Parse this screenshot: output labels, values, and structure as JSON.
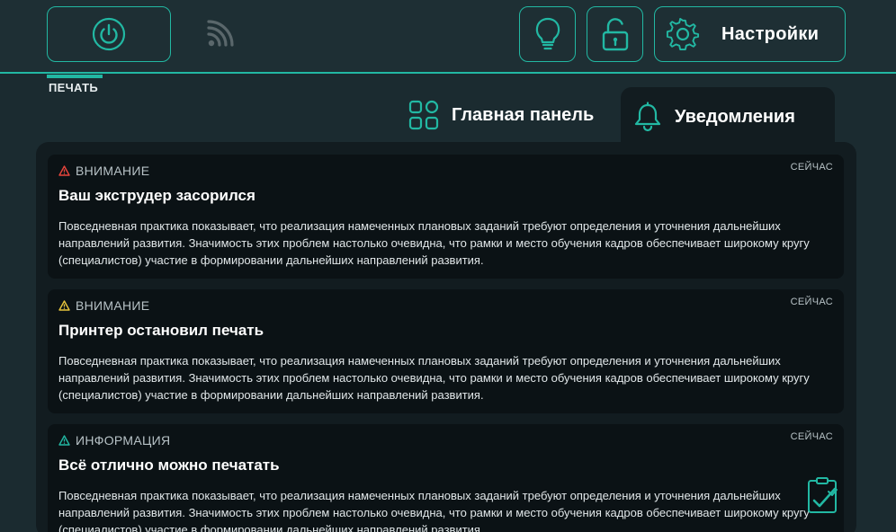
{
  "header": {
    "settings_label": "Настройки",
    "print_tab_label": "ПЕЧАТЬ",
    "accent_color": "#22b8a3"
  },
  "icons": {
    "power": "power-icon",
    "wifi": "wifi-signal-icon",
    "bulb": "lightbulb-icon",
    "lock": "unlock-icon",
    "settings": "gear-icon",
    "dashboard": "dashboard-grid-icon",
    "notifications": "bell-icon",
    "clipboard": "clipboard-check-icon"
  },
  "tabs": {
    "main_label": "Главная панель",
    "notifications_label": "Уведомления"
  },
  "notifications": [
    {
      "level": "ВНИМАНИЕ",
      "level_color": "#e8453c",
      "time": "СЕЙЧАС",
      "title": "Ваш экструдер засорился",
      "body": "Повседневная практика показывает, что реализация намеченных плановых заданий требуют определения и уточнения дальнейших направлений развития. Значимость этих проблем настолько очевидна, что рамки и место обучения кадров обеспечивает широкому кругу (специалистов) участие в формировании дальнейших направлений развития."
    },
    {
      "level": "ВНИМАНИЕ",
      "level_color": "#e8c53c",
      "time": "СЕЙЧАС",
      "title": "Принтер остановил печать",
      "body": "Повседневная практика показывает, что реализация намеченных плановых заданий требуют определения и уточнения дальнейших направлений развития. Значимость этих проблем настолько очевидна, что рамки и место обучения кадров обеспечивает широкому кругу (специалистов) участие в формировании дальнейших направлений развития."
    },
    {
      "level": "ИНФОРМАЦИЯ",
      "level_color": "#22b8a3",
      "time": "СЕЙЧАС",
      "title": "Всё отлично можно печатать",
      "body": "Повседневная практика показывает, что реализация намеченных плановых заданий требуют определения и уточнения дальнейших направлений развития. Значимость этих проблем настолько очевидна, что рамки и место обучения кадров обеспечивает широкому кругу (специалистов) участие в формировании дальнейших направлений развития."
    }
  ]
}
